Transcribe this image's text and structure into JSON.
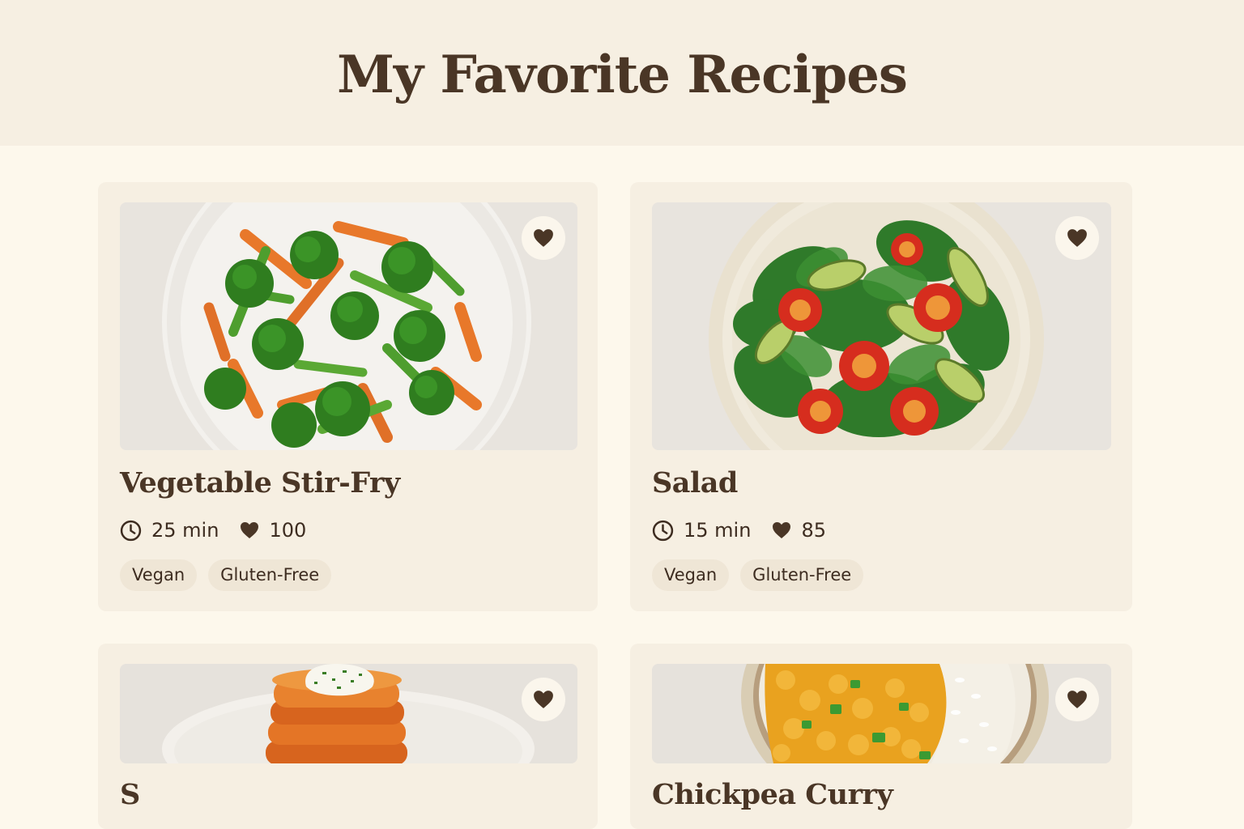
{
  "header": {
    "title": "My Favorite Recipes"
  },
  "recipes": [
    {
      "title": "Vegetable Stir-Fry",
      "time": "25 min",
      "likes": "100",
      "tags": [
        "Vegan",
        "Gluten-Free"
      ]
    },
    {
      "title": "Salad",
      "time": "15 min",
      "likes": "85",
      "tags": [
        "Vegan",
        "Gluten-Free"
      ]
    },
    {
      "title": "S"
    },
    {
      "title": "Chickpea Curry"
    }
  ],
  "icons": {
    "clock": "clock-icon",
    "heart": "heart-icon"
  },
  "colors": {
    "background": "#fdf8ec",
    "header": "#f6efe2",
    "card": "#f6efe2",
    "text": "#4a3626",
    "tag": "#efe6d6",
    "favorite_button": "#fbf6ec"
  }
}
